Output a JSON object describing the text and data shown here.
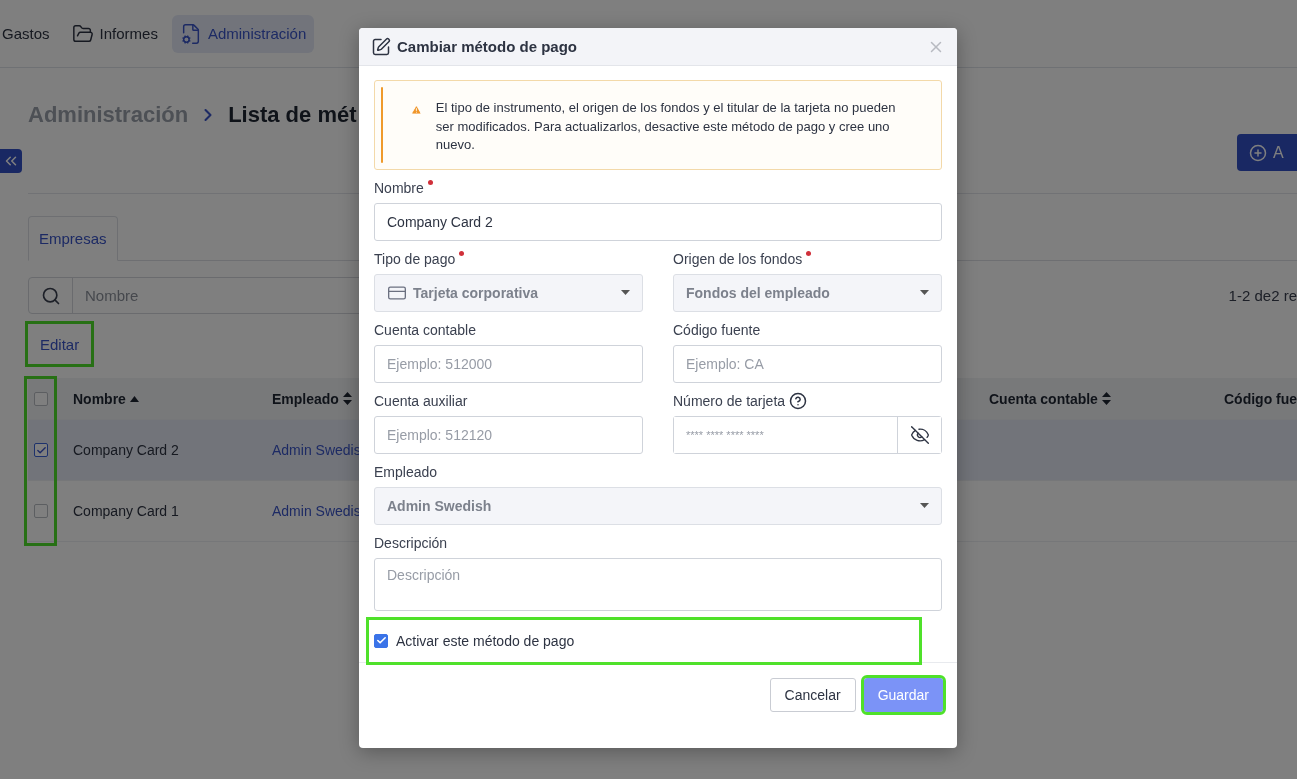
{
  "nav": {
    "items": [
      {
        "label": "Gastos",
        "selected": false
      },
      {
        "label": "Informes",
        "selected": false
      },
      {
        "label": "Administración",
        "selected": true
      }
    ]
  },
  "breadcrumb": {
    "parent": "Administración",
    "current": "Lista de mét"
  },
  "add_button": {
    "label": "A"
  },
  "tabs": [
    {
      "label": "Empresas",
      "selected": true
    }
  ],
  "search": {
    "placeholder": "Nombre"
  },
  "result_count": "1-2 de2 re",
  "edit_button": {
    "label": "Editar",
    "highlighted": true
  },
  "table": {
    "select_column_highlighted": true,
    "header_checked": false,
    "columns": [
      {
        "label": "Nombre",
        "sorted": true
      },
      {
        "label": "Empleado",
        "sorted": false
      },
      {
        "label": "Cuenta contable",
        "sorted": false
      },
      {
        "label": "Código fue"
      }
    ],
    "rows": [
      {
        "selected": true,
        "checked": true,
        "cells": [
          "Company Card 2",
          "Admin Swedis"
        ]
      },
      {
        "selected": false,
        "checked": false,
        "cells": [
          "Company Card 1",
          "Admin Swedis"
        ]
      }
    ]
  },
  "modal": {
    "title": "Cambiar método de pago",
    "warning": "El tipo de instrumento, el origen de los fondos y el titular de la tarjeta no pueden ser modificados. Para actualizarlos, desactive este método de pago y cree uno nuevo.",
    "rows": [
      [
        {
          "kind": "text",
          "label": "Nombre",
          "required": true,
          "value": "Company Card 2"
        }
      ],
      [
        {
          "kind": "select",
          "label": "Tipo de pago",
          "required": true,
          "value": "Tarjeta corporativa",
          "card_icon": true,
          "disabled": true
        },
        {
          "kind": "select",
          "label": "Origen de los fondos",
          "required": true,
          "value": "Fondos del empleado",
          "disabled": true
        }
      ],
      [
        {
          "kind": "text",
          "label": "Cuenta contable",
          "required": false,
          "placeholder": "Ejemplo: 512000"
        },
        {
          "kind": "text",
          "label": "Código fuente",
          "required": false,
          "placeholder": "Ejemplo: CA"
        }
      ],
      [
        {
          "kind": "text",
          "label": "Cuenta auxiliar",
          "required": false,
          "placeholder": "Ejemplo: 512120"
        },
        {
          "kind": "secret",
          "label": "Número de tarjeta",
          "required": false,
          "help": true,
          "placeholder": "**** **** **** ****"
        }
      ],
      [
        {
          "kind": "select",
          "label": "Empleado",
          "required": false,
          "value": "Admin Swedish",
          "disabled": true
        }
      ],
      [
        {
          "kind": "textarea",
          "label": "Descripción",
          "required": false,
          "placeholder": "Descripción"
        }
      ]
    ],
    "active_checkbox": {
      "label": "Activar este método de pago",
      "checked": true,
      "highlighted": true
    },
    "buttons": [
      {
        "label": "Cancelar",
        "kind": "secondary",
        "highlighted": false
      },
      {
        "label": "Guardar",
        "kind": "primary",
        "highlighted": true
      }
    ]
  }
}
